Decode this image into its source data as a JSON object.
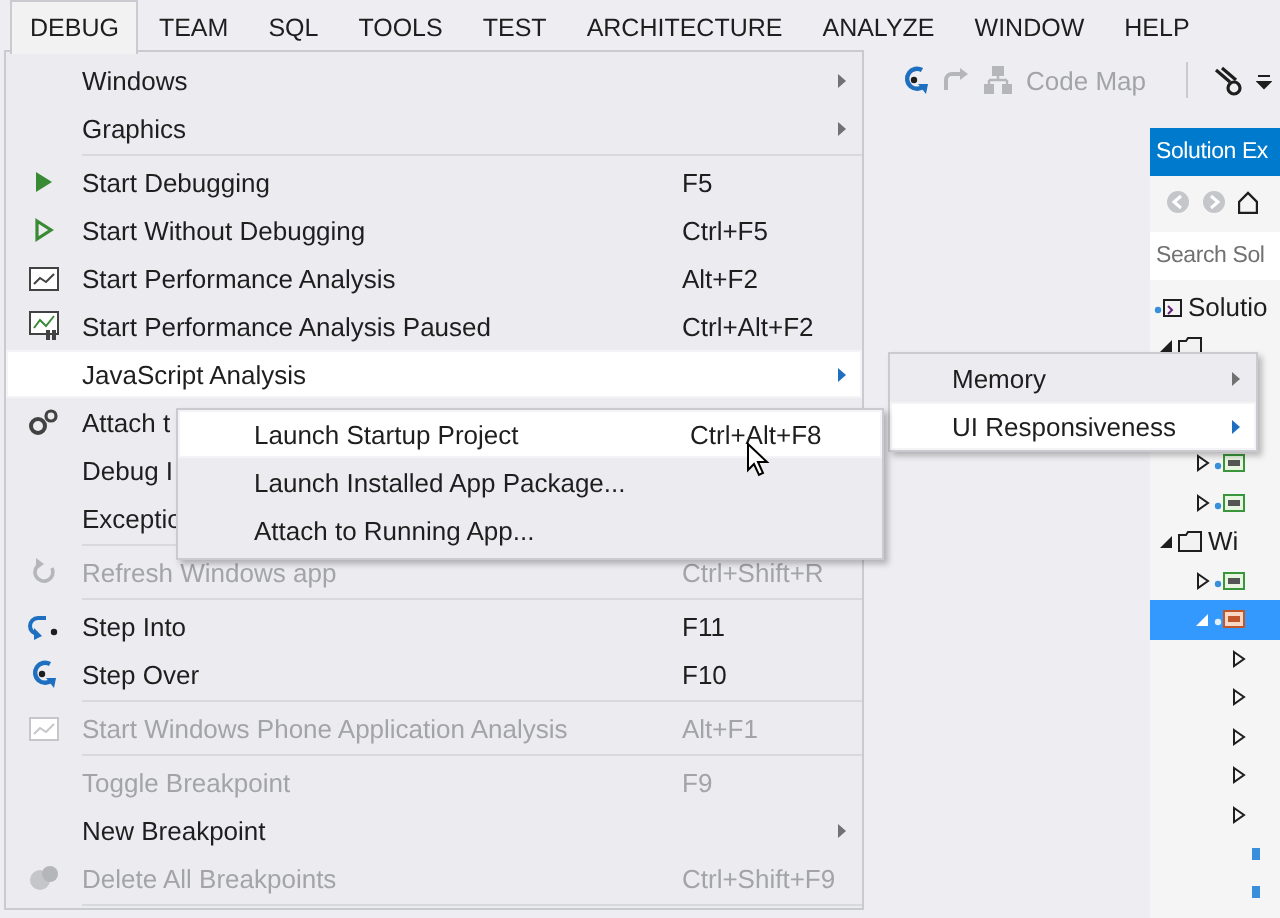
{
  "menu_bar": [
    {
      "label": "DEBUG",
      "selected": true
    },
    {
      "label": "TEAM",
      "selected": false
    },
    {
      "label": "SQL",
      "selected": false
    },
    {
      "label": "TOOLS",
      "selected": false
    },
    {
      "label": "TEST",
      "selected": false
    },
    {
      "label": "ARCHITECTURE",
      "selected": false
    },
    {
      "label": "ANALYZE",
      "selected": false
    },
    {
      "label": "WINDOW",
      "selected": false
    },
    {
      "label": "HELP",
      "selected": false
    }
  ],
  "toolbar": {
    "code_map": "Code Map"
  },
  "solution_explorer": {
    "title": "Solution Ex",
    "search": {
      "placeholder": "Search Sol"
    },
    "tree": [
      {
        "label": "Solutio",
        "kind": "solution",
        "selected": false,
        "children": [
          {
            "kind": "folder",
            "expanded": true,
            "selected": false,
            "children": [
              {
                "kind": "csharp",
                "expanded": false,
                "selected": false
              },
              {
                "kind": "csharp",
                "expanded": false,
                "selected": false
              }
            ]
          },
          {
            "label": "Wi",
            "kind": "folder",
            "expanded": true,
            "selected": false,
            "children": [
              {
                "kind": "csharp",
                "expanded": false,
                "selected": false
              },
              {
                "kind": "js",
                "expanded": true,
                "selected": true,
                "children": [
                  {
                    "kind": "item",
                    "expanded": false,
                    "selected": false
                  },
                  {
                    "kind": "item",
                    "expanded": false,
                    "selected": false
                  },
                  {
                    "kind": "item",
                    "expanded": false,
                    "selected": false
                  },
                  {
                    "kind": "item",
                    "expanded": false,
                    "selected": false
                  },
                  {
                    "kind": "item",
                    "expanded": false,
                    "selected": false
                  },
                  {
                    "kind": "file",
                    "selected": false
                  },
                  {
                    "kind": "file",
                    "selected": false
                  }
                ]
              }
            ]
          }
        ]
      }
    ]
  },
  "debug_menu": [
    {
      "kind": "plain",
      "label": "Windows",
      "submenu": true,
      "disabled": false,
      "selected": false
    },
    {
      "kind": "plain",
      "label": "Graphics",
      "submenu": true,
      "disabled": false,
      "selected": false
    },
    {
      "kind": "separator"
    },
    {
      "kind": "start",
      "label": "Start Debugging",
      "shortcut": "F5",
      "submenu": false,
      "disabled": false,
      "selected": false
    },
    {
      "kind": "start-no-debug",
      "label": "Start Without Debugging",
      "shortcut": "Ctrl+F5",
      "submenu": false,
      "disabled": false,
      "selected": false
    },
    {
      "kind": "performance",
      "label": "Start Performance Analysis",
      "shortcut": "Alt+F2",
      "submenu": false,
      "disabled": false,
      "selected": false
    },
    {
      "kind": "performance-paused",
      "label": "Start Performance Analysis Paused",
      "shortcut": "Ctrl+Alt+F2",
      "submenu": false,
      "disabled": false,
      "selected": false
    },
    {
      "kind": "plain",
      "label": "JavaScript Analysis",
      "submenu": true,
      "disabled": false,
      "selected": true
    },
    {
      "kind": "attach",
      "label": "Attach t",
      "submenu": false,
      "disabled": false,
      "selected": false
    },
    {
      "kind": "plain",
      "label": "Debug I",
      "submenu": false,
      "disabled": false,
      "selected": false
    },
    {
      "kind": "plain",
      "label": "Exceptio",
      "submenu": false,
      "disabled": false,
      "selected": false
    },
    {
      "kind": "separator"
    },
    {
      "kind": "refresh",
      "label": "Refresh Windows app",
      "shortcut": "Ctrl+Shift+R",
      "submenu": false,
      "disabled": true,
      "selected": false
    },
    {
      "kind": "separator"
    },
    {
      "kind": "step-into",
      "label": "Step Into",
      "shortcut": "F11",
      "submenu": false,
      "disabled": false,
      "selected": false
    },
    {
      "kind": "step-over",
      "label": "Step Over",
      "shortcut": "F10",
      "submenu": false,
      "disabled": false,
      "selected": false
    },
    {
      "kind": "separator"
    },
    {
      "kind": "phone-analysis",
      "label": "Start Windows Phone Application Analysis",
      "shortcut": "Alt+F1",
      "submenu": false,
      "disabled": true,
      "selected": false
    },
    {
      "kind": "separator"
    },
    {
      "kind": "plain",
      "label": "Toggle Breakpoint",
      "shortcut": "F9",
      "submenu": false,
      "disabled": true,
      "selected": false
    },
    {
      "kind": "plain",
      "label": "New Breakpoint",
      "submenu": true,
      "disabled": false,
      "selected": false
    },
    {
      "kind": "delete-breakpoints",
      "label": "Delete All Breakpoints",
      "shortcut": "Ctrl+Shift+F9",
      "submenu": false,
      "disabled": true,
      "selected": false
    },
    {
      "kind": "separator"
    }
  ],
  "javascript_analysis_menu": [
    {
      "label": "Memory",
      "submenu": true,
      "disabled": false,
      "selected": false
    },
    {
      "label": "UI Responsiveness",
      "submenu": true,
      "disabled": false,
      "selected": true
    }
  ],
  "launch_menu": [
    {
      "label": "Launch Startup Project",
      "shortcut": "Ctrl+Alt+F8",
      "submenu": false,
      "disabled": false,
      "selected": true
    },
    {
      "label": "Launch Installed App Package...",
      "submenu": false,
      "disabled": false,
      "selected": false
    },
    {
      "label": "Attach to Running App...",
      "submenu": false,
      "disabled": false,
      "selected": false
    }
  ]
}
